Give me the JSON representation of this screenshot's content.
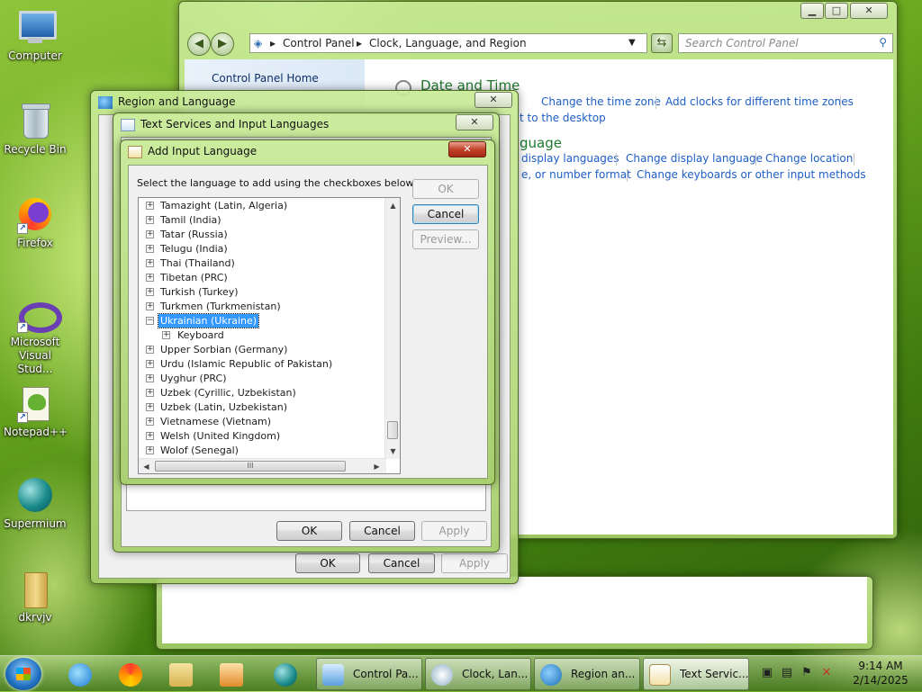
{
  "desktop": {
    "icons": [
      {
        "label": "Computer"
      },
      {
        "label": "Recycle Bin"
      },
      {
        "label": "Firefox"
      },
      {
        "label": "Microsoft Visual Stud..."
      },
      {
        "label": "Notepad++"
      },
      {
        "label": "Supermium"
      },
      {
        "label": "dkrvjv"
      }
    ]
  },
  "control_panel": {
    "breadcrumb": [
      "Control Panel",
      "Clock, Language, and Region"
    ],
    "search_placeholder": "Search Control Panel",
    "left_nav": [
      "Control Panel Home"
    ],
    "date_time": {
      "heading": "Date and Time",
      "links": [
        "Change the time zone",
        "Add clocks for different time zones"
      ],
      "link_partial": "t to the desktop"
    },
    "region": {
      "heading_partial": "guage",
      "links_row1": [
        "display languages",
        "Change display language",
        "Change location"
      ],
      "links_row2": [
        "e, or number format",
        "Change keyboards or other input methods"
      ]
    }
  },
  "region_language": {
    "title": "Region and Language",
    "buttons": {
      "ok": "OK",
      "cancel": "Cancel",
      "apply": "Apply"
    }
  },
  "text_services": {
    "title": "Text Services and Input Languages",
    "buttons": {
      "ok": "OK",
      "cancel": "Cancel",
      "apply": "Apply"
    }
  },
  "add_input_language": {
    "title": "Add Input Language",
    "instruction": "Select the language to add using the checkboxes below.",
    "buttons": {
      "ok": "OK",
      "cancel": "Cancel",
      "preview": "Preview..."
    },
    "languages": [
      {
        "label": "Tamazight (Latin, Algeria)"
      },
      {
        "label": "Tamil (India)"
      },
      {
        "label": "Tatar (Russia)"
      },
      {
        "label": "Telugu (India)"
      },
      {
        "label": "Thai (Thailand)"
      },
      {
        "label": "Tibetan (PRC)"
      },
      {
        "label": "Turkish (Turkey)"
      },
      {
        "label": "Turkmen (Turkmenistan)"
      },
      {
        "label": "Ukrainian (Ukraine)",
        "selected": true,
        "expanded": true
      },
      {
        "label": "Keyboard",
        "child": true
      },
      {
        "label": "Upper Sorbian (Germany)"
      },
      {
        "label": "Urdu (Islamic Republic of Pakistan)"
      },
      {
        "label": "Uyghur (PRC)"
      },
      {
        "label": "Uzbek (Cyrillic, Uzbekistan)"
      },
      {
        "label": "Uzbek (Latin, Uzbekistan)"
      },
      {
        "label": "Vietnamese (Vietnam)"
      },
      {
        "label": "Welsh (United Kingdom)"
      },
      {
        "label": "Wolof (Senegal)"
      }
    ],
    "hscroll_grip": "III"
  },
  "taskbar": {
    "tasks": [
      {
        "label": "Control Pa..."
      },
      {
        "label": "Clock, Lan..."
      },
      {
        "label": "Region an..."
      },
      {
        "label": "Text Servic...",
        "active": true
      }
    ],
    "clock": {
      "time": "9:14 AM",
      "date": "2/14/2025"
    }
  }
}
